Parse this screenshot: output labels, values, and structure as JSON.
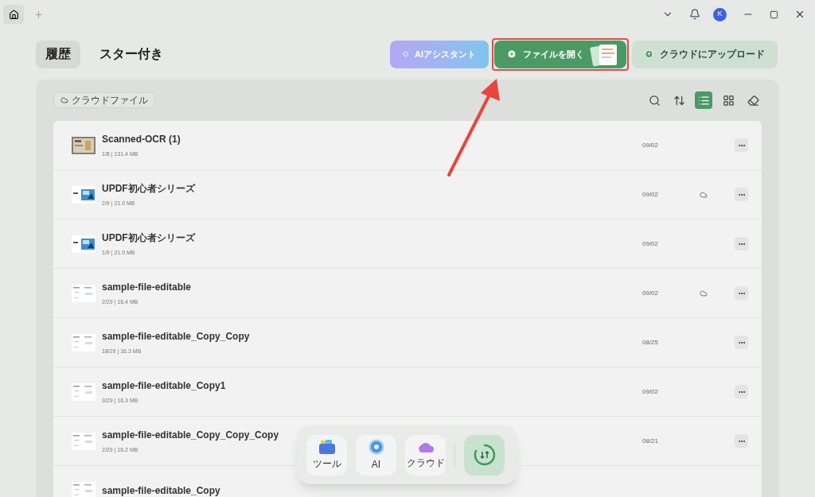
{
  "titlebar": {
    "avatar": "K"
  },
  "tabs": [
    {
      "label": "履歴",
      "selected": true
    },
    {
      "label": "スター付き",
      "selected": false
    }
  ],
  "actions": [
    {
      "kind": "ai",
      "label": "AIアシスタント",
      "highlighted": false
    },
    {
      "kind": "open",
      "label": "ファイルを開く",
      "highlighted": true
    },
    {
      "kind": "upload",
      "label": "クラウドにアップロード",
      "highlighted": false
    }
  ],
  "filter_chip": "クラウドファイル",
  "view_tools": [
    {
      "kind": "search",
      "selected": false
    },
    {
      "kind": "sort",
      "selected": false
    },
    {
      "kind": "list",
      "selected": true
    },
    {
      "kind": "grid",
      "selected": false
    },
    {
      "kind": "clean",
      "selected": false
    }
  ],
  "files": [
    {
      "name": "Scanned-OCR (1)",
      "meta": "1/8 | 131.4 MB",
      "date": "09/02",
      "cloud": false
    },
    {
      "name": "UPDF初心者シリーズ",
      "meta": "2/9 | 21.0 MB",
      "date": "09/02",
      "cloud": true
    },
    {
      "name": "UPDF初心者シリーズ",
      "meta": "1/9 | 21.0 MB",
      "date": "09/02",
      "cloud": false
    },
    {
      "name": "sample-file-editable",
      "meta": "2/29 | 16.4 MB",
      "date": "09/02",
      "cloud": true
    },
    {
      "name": "sample-file-editable_Copy_Copy",
      "meta": "18/29 | 16.3 MB",
      "date": "08/25",
      "cloud": false
    },
    {
      "name": "sample-file-editable_Copy1",
      "meta": "3/29 | 16.3 MB",
      "date": "09/02",
      "cloud": false
    },
    {
      "name": "sample-file-editable_Copy_Copy_Copy",
      "meta": "2/29 | 16.2 MB",
      "date": "08/21",
      "cloud": false
    },
    {
      "name": "sample-file-editable_Copy"
    }
  ],
  "dock": [
    {
      "kind": "tools",
      "label": "ツール",
      "selected": false
    },
    {
      "kind": "ai",
      "label": "AI",
      "selected": false
    },
    {
      "kind": "cloud",
      "label": "クラウド",
      "selected": false
    },
    {
      "kind": "history",
      "selected": true
    }
  ]
}
